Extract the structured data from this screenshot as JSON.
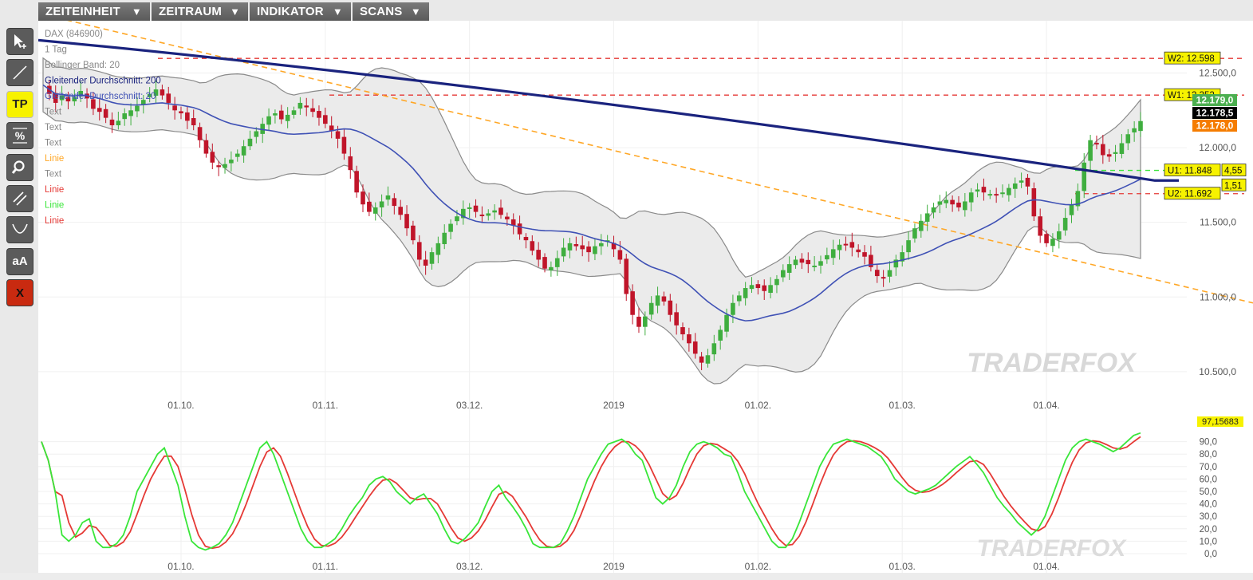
{
  "menu": [
    {
      "label": "ZEITEINHEIT",
      "arrow": "▼"
    },
    {
      "label": "ZEITRAUM",
      "arrow": "▼"
    },
    {
      "label": "INDIKATOR",
      "arrow": "▼"
    },
    {
      "label": "SCANS",
      "arrow": "▼"
    }
  ],
  "toolbar": [
    {
      "name": "pointer-tool",
      "icon": "cursor-plus-icon",
      "label": ""
    },
    {
      "name": "line-tool",
      "icon": "diagonal-line-icon",
      "label": ""
    },
    {
      "name": "tp-tool",
      "icon": "tp-icon",
      "label": "TP"
    },
    {
      "name": "percent-tool",
      "icon": "percent-icon",
      "label": "%"
    },
    {
      "name": "zoom-tool",
      "icon": "magnifier-icon",
      "label": ""
    },
    {
      "name": "parallel-lines-tool",
      "icon": "parallel-lines-icon",
      "label": ""
    },
    {
      "name": "curve-tool",
      "icon": "curve-icon",
      "label": ""
    },
    {
      "name": "font-size-tool",
      "icon": "text-size-icon",
      "label": "aA"
    },
    {
      "name": "delete-tool",
      "icon": "close-icon",
      "label": "X"
    }
  ],
  "legend": [
    {
      "text": "DAX (846900)",
      "color": "#888888"
    },
    {
      "text": "1 Tag",
      "color": "#888888"
    },
    {
      "text": "Bollinger Band: 20",
      "color": "#888888"
    },
    {
      "text": "Gleitender Durchschnitt: 200",
      "color": "#1a237e"
    },
    {
      "text": "Gleitender Durchschnitt: 20",
      "color": "#3f51b5"
    },
    {
      "text": "Text",
      "color": "#888888"
    },
    {
      "text": "Text",
      "color": "#888888"
    },
    {
      "text": "Text",
      "color": "#888888"
    },
    {
      "text": "Linie",
      "color": "#ffa726"
    },
    {
      "text": "Text",
      "color": "#888888"
    },
    {
      "text": "Linie",
      "color": "#e53935"
    },
    {
      "text": "Linie",
      "color": "#39e639"
    },
    {
      "text": "Linie",
      "color": "#e53935"
    }
  ],
  "price_axis": [
    "12.500,0",
    "12.000,0",
    "11.500,0",
    "11.000,0",
    "10.500,0"
  ],
  "price_tags": [
    {
      "text": "12.179,0",
      "bg": "#4caf50",
      "fg": "#ffffff"
    },
    {
      "text": "12.178,5",
      "bg": "#000000",
      "fg": "#ffffff"
    },
    {
      "text": "12.178,0",
      "bg": "#f57c00",
      "fg": "#ffffff"
    }
  ],
  "level_labels": [
    {
      "text": "W2: 12.598",
      "price": 12598,
      "color": "#e53935"
    },
    {
      "text": "W1: 12.352",
      "price": 12352,
      "color": "#e53935"
    },
    {
      "text": "U1: 11.848",
      "price": 11848,
      "color": "#39e639"
    },
    {
      "text": "U2: 11.692",
      "price": 11692,
      "color": "#e53935"
    }
  ],
  "partial_labels": [
    "4,55",
    "1,51"
  ],
  "date_axis": [
    "01.10.",
    "01.11.",
    "03.12.",
    "2019",
    "01.02.",
    "01.03.",
    "01.04."
  ],
  "watermark": "TRADERFOX",
  "osc_axis": [
    "90,0",
    "80,0",
    "70,0",
    "60,0",
    "50,0",
    "40,0",
    "30,0",
    "20,0",
    "10,0",
    "0,0"
  ],
  "osc_value_tag": "97,15683",
  "colors": {
    "up": "#3fae3f",
    "down": "#c0152a",
    "ma200": "#1a237e",
    "ma20": "#3f51b5",
    "osc_fast": "#39e639",
    "osc_slow": "#e53935",
    "trend": "#ffa726"
  },
  "chart_data": {
    "type": "candlestick",
    "symbol": "DAX (846900)",
    "interval": "1 Tag",
    "ylim": [
      10200,
      12850
    ],
    "closes": [
      12420,
      12360,
      12300,
      12350,
      12310,
      12340,
      12380,
      12330,
      12260,
      12240,
      12200,
      12150,
      12180,
      12230,
      12250,
      12280,
      12320,
      12360,
      12390,
      12350,
      12300,
      12250,
      12230,
      12180,
      12150,
      12050,
      11960,
      11900,
      11870,
      11890,
      11920,
      11960,
      12010,
      12060,
      12110,
      12160,
      12210,
      12230,
      12190,
      12220,
      12250,
      12300,
      12270,
      12240,
      12200,
      12160,
      12110,
      12060,
      11960,
      11850,
      11700,
      11620,
      11570,
      11600,
      11640,
      11680,
      11610,
      11550,
      11460,
      11380,
      11250,
      11210,
      11300,
      11360,
      11430,
      11490,
      11540,
      11590,
      11600,
      11570,
      11550,
      11560,
      11580,
      11550,
      11520,
      11480,
      11420,
      11380,
      11310,
      11250,
      11190,
      11200,
      11260,
      11330,
      11360,
      11340,
      11320,
      11300,
      11340,
      11360,
      11380,
      11320,
      11250,
      11020,
      10880,
      10800,
      10870,
      10960,
      11010,
      10970,
      10880,
      10810,
      10750,
      10690,
      10620,
      10560,
      10610,
      10690,
      10780,
      10880,
      10960,
      11010,
      11060,
      11080,
      11060,
      11040,
      11080,
      11120,
      11180,
      11220,
      11250,
      11230,
      11220,
      11210,
      11240,
      11280,
      11320,
      11350,
      11350,
      11330,
      11300,
      11270,
      11200,
      11140,
      11130,
      11180,
      11250,
      11300,
      11380,
      11460,
      11510,
      11560,
      11600,
      11640,
      11650,
      11620,
      11600,
      11640,
      11700,
      11720,
      11700,
      11690,
      11680,
      11700,
      11730,
      11760,
      11780,
      11740,
      11540,
      11410,
      11360,
      11390,
      11440,
      11530,
      11620,
      11710,
      11900,
      12050,
      12030,
      11950,
      11940,
      11970,
      12030,
      12090,
      12130,
      12178
    ],
    "x_ticks": [
      "01.10.",
      "01.11.",
      "03.12.",
      "2019",
      "01.02.",
      "01.03.",
      "01.04."
    ],
    "levels": [
      12598,
      12352,
      11848,
      11692
    ],
    "oscillator": {
      "ylim": [
        0,
        100
      ],
      "fast": [
        90,
        75,
        50,
        15,
        10,
        15,
        25,
        28,
        10,
        5,
        5,
        8,
        15,
        30,
        50,
        60,
        70,
        80,
        85,
        70,
        55,
        30,
        10,
        5,
        3,
        5,
        8,
        15,
        25,
        40,
        55,
        70,
        85,
        90,
        80,
        65,
        50,
        35,
        20,
        10,
        5,
        5,
        8,
        12,
        20,
        30,
        38,
        45,
        55,
        60,
        62,
        58,
        50,
        45,
        40,
        45,
        48,
        40,
        32,
        20,
        10,
        8,
        12,
        18,
        25,
        38,
        50,
        55,
        45,
        38,
        30,
        20,
        8,
        5,
        5,
        5,
        8,
        18,
        30,
        45,
        60,
        70,
        80,
        88,
        90,
        92,
        88,
        80,
        75,
        60,
        45,
        40,
        45,
        55,
        70,
        82,
        88,
        90,
        88,
        85,
        80,
        78,
        65,
        50,
        40,
        30,
        20,
        10,
        5,
        5,
        12,
        25,
        40,
        55,
        70,
        80,
        88,
        90,
        92,
        90,
        88,
        86,
        82,
        78,
        70,
        60,
        55,
        50,
        48,
        50,
        52,
        55,
        60,
        65,
        70,
        74,
        78,
        72,
        65,
        55,
        45,
        38,
        32,
        25,
        20,
        15,
        20,
        30,
        45,
        60,
        75,
        85,
        90,
        92,
        90,
        88,
        85,
        82,
        85,
        90,
        95,
        97
      ]
    }
  }
}
